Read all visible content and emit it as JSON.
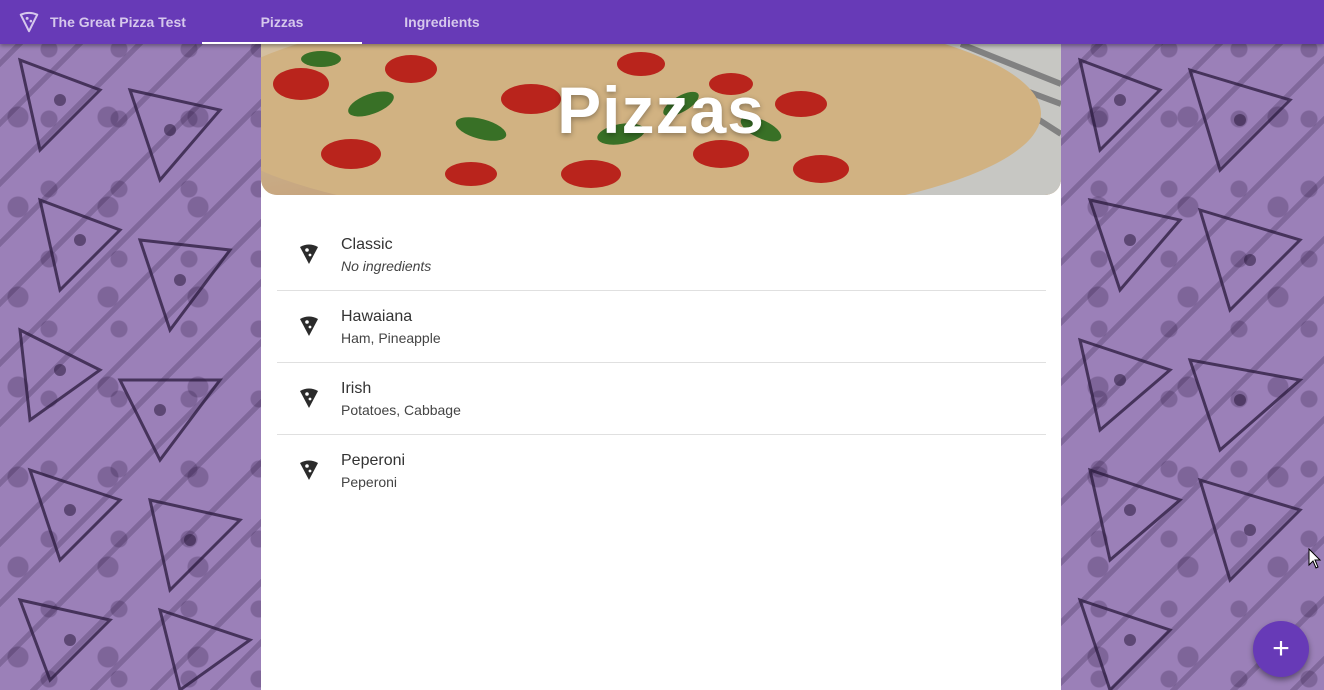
{
  "app": {
    "title": "The Great Pizza Test",
    "brand_icon": "pizza-slice-icon",
    "accent_color": "#673ab7"
  },
  "tabs": [
    {
      "label": "Pizzas",
      "active": true
    },
    {
      "label": "Ingredients",
      "active": false
    }
  ],
  "hero": {
    "title": "Pizzas"
  },
  "pizzas": [
    {
      "name": "Classic",
      "ingredients": "No ingredients",
      "icon": "pizza-slice-icon"
    },
    {
      "name": "Hawaiana",
      "ingredients": "Ham, Pineapple",
      "icon": "pizza-slice-icon"
    },
    {
      "name": "Irish",
      "ingredients": "Potatoes, Cabbage",
      "icon": "pizza-slice-icon"
    },
    {
      "name": "Peperoni",
      "ingredients": "Peperoni",
      "icon": "pizza-slice-icon"
    }
  ],
  "fab": {
    "label": "+",
    "icon": "add-icon"
  }
}
